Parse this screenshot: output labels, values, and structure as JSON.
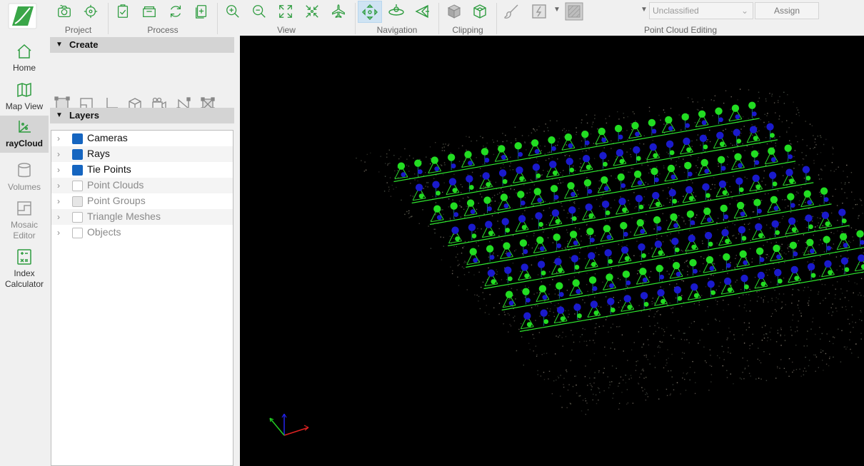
{
  "modes": [
    {
      "label": "Home",
      "icon": "home-icon",
      "state": "normal"
    },
    {
      "label": "Map View",
      "icon": "map-icon",
      "state": "normal"
    },
    {
      "label": "rayCloud",
      "icon": "raycloud-icon",
      "state": "active"
    },
    {
      "label": "Volumes",
      "icon": "volumes-icon",
      "state": "disabled"
    },
    {
      "label": "Mosaic Editor",
      "icon": "mosaic-icon",
      "state": "disabled"
    },
    {
      "label": "Index Calculator",
      "icon": "calculator-icon",
      "state": "normal"
    }
  ],
  "ribbon": {
    "groups": {
      "project": "Project",
      "process": "Process",
      "view": "View",
      "navigation": "Navigation",
      "clipping": "Clipping",
      "editing": "Point Cloud Editing"
    },
    "class_select": "Unclassified",
    "assign_label": "Assign"
  },
  "sidebar": {
    "create_title": "Create",
    "layers_title": "Layers",
    "layers": [
      {
        "label": "Cameras",
        "checked": "on"
      },
      {
        "label": "Rays",
        "checked": "on"
      },
      {
        "label": "Tie Points",
        "checked": "on"
      },
      {
        "label": "Point Clouds",
        "checked": "off"
      },
      {
        "label": "Point Groups",
        "checked": "partial"
      },
      {
        "label": "Triangle Meshes",
        "checked": "off"
      },
      {
        "label": "Objects",
        "checked": "off"
      }
    ]
  },
  "colors": {
    "accent": "#2e9c3f",
    "camera_green": "#22dd22",
    "camera_blue": "#1a1acc",
    "frame_green": "#33ff33",
    "checkbox_blue": "#1565c0"
  }
}
